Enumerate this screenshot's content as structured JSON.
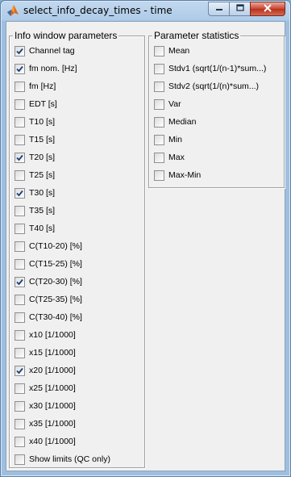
{
  "window": {
    "title": "select_info_decay_times - time"
  },
  "info_group": {
    "title": "Info window parameters",
    "items": [
      {
        "label": "Channel tag",
        "checked": true
      },
      {
        "label": "fm nom. [Hz]",
        "checked": true
      },
      {
        "label": "fm [Hz]",
        "checked": false
      },
      {
        "label": "EDT [s]",
        "checked": false
      },
      {
        "label": "T10 [s]",
        "checked": false
      },
      {
        "label": "T15 [s]",
        "checked": false
      },
      {
        "label": "T20 [s]",
        "checked": true
      },
      {
        "label": "T25 [s]",
        "checked": false
      },
      {
        "label": "T30 [s]",
        "checked": true
      },
      {
        "label": "T35 [s]",
        "checked": false
      },
      {
        "label": "T40 [s]",
        "checked": false
      },
      {
        "label": "C(T10-20) [%]",
        "checked": false
      },
      {
        "label": "C(T15-25) [%]",
        "checked": false
      },
      {
        "label": "C(T20-30) [%]",
        "checked": true
      },
      {
        "label": "C(T25-35) [%]",
        "checked": false
      },
      {
        "label": "C(T30-40) [%]",
        "checked": false
      },
      {
        "label": "x10 [1/1000]",
        "checked": false
      },
      {
        "label": "x15 [1/1000]",
        "checked": false
      },
      {
        "label": "x20 [1/1000]",
        "checked": true
      },
      {
        "label": "x25 [1/1000]",
        "checked": false
      },
      {
        "label": "x30 [1/1000]",
        "checked": false
      },
      {
        "label": "x35 [1/1000]",
        "checked": false
      },
      {
        "label": "x40 [1/1000]",
        "checked": false
      },
      {
        "label": "Show limits (QC only)",
        "checked": false
      }
    ]
  },
  "stats_group": {
    "title": "Parameter statistics",
    "items": [
      {
        "label": "Mean",
        "checked": false
      },
      {
        "label": "Stdv1 (sqrt(1/(n-1)*sum...)",
        "checked": false
      },
      {
        "label": "Stdv2 (sqrt(1/(n)*sum...)",
        "checked": false
      },
      {
        "label": "Var",
        "checked": false
      },
      {
        "label": "Median",
        "checked": false
      },
      {
        "label": "Min",
        "checked": false
      },
      {
        "label": "Max",
        "checked": false
      },
      {
        "label": "Max-Min",
        "checked": false
      }
    ]
  },
  "icons": {
    "app": "matlab-icon",
    "minimize": "minimize-icon",
    "maximize": "maximize-icon",
    "close": "close-icon",
    "check": "checkmark-icon"
  },
  "colors": {
    "title_bar": "#aecbe8",
    "client_bg": "#f0f0f0",
    "close_button": "#c9442f",
    "check": "#1a3f7a"
  }
}
